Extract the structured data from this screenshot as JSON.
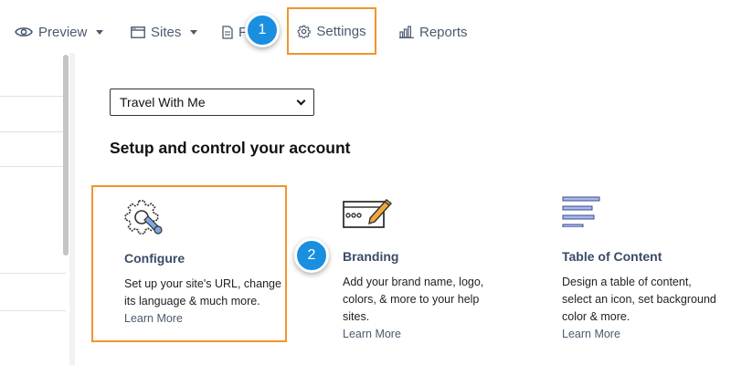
{
  "nav": {
    "preview": "Preview",
    "sites": "Sites",
    "partial": "F",
    "settings": "Settings",
    "reports": "Reports"
  },
  "badges": {
    "one": "1",
    "two": "2"
  },
  "site_select": {
    "value": "Travel With Me"
  },
  "heading": "Setup and control your account",
  "cards": [
    {
      "title": "Configure",
      "desc": "Set up your site's URL, change its language & much more.",
      "link": "Learn More"
    },
    {
      "title": "Branding",
      "desc": "Add your brand name, logo, colors, & more to your help sites.",
      "link": "Learn More"
    },
    {
      "title": "Table of Content",
      "desc": "Design a table of content, select an icon, set background color & more.",
      "link": "Learn More"
    }
  ],
  "colors": {
    "accent": "#f0952b",
    "badge": "#1a8fe0",
    "title": "#3a4b67",
    "nav_text": "#4a5a6e"
  }
}
